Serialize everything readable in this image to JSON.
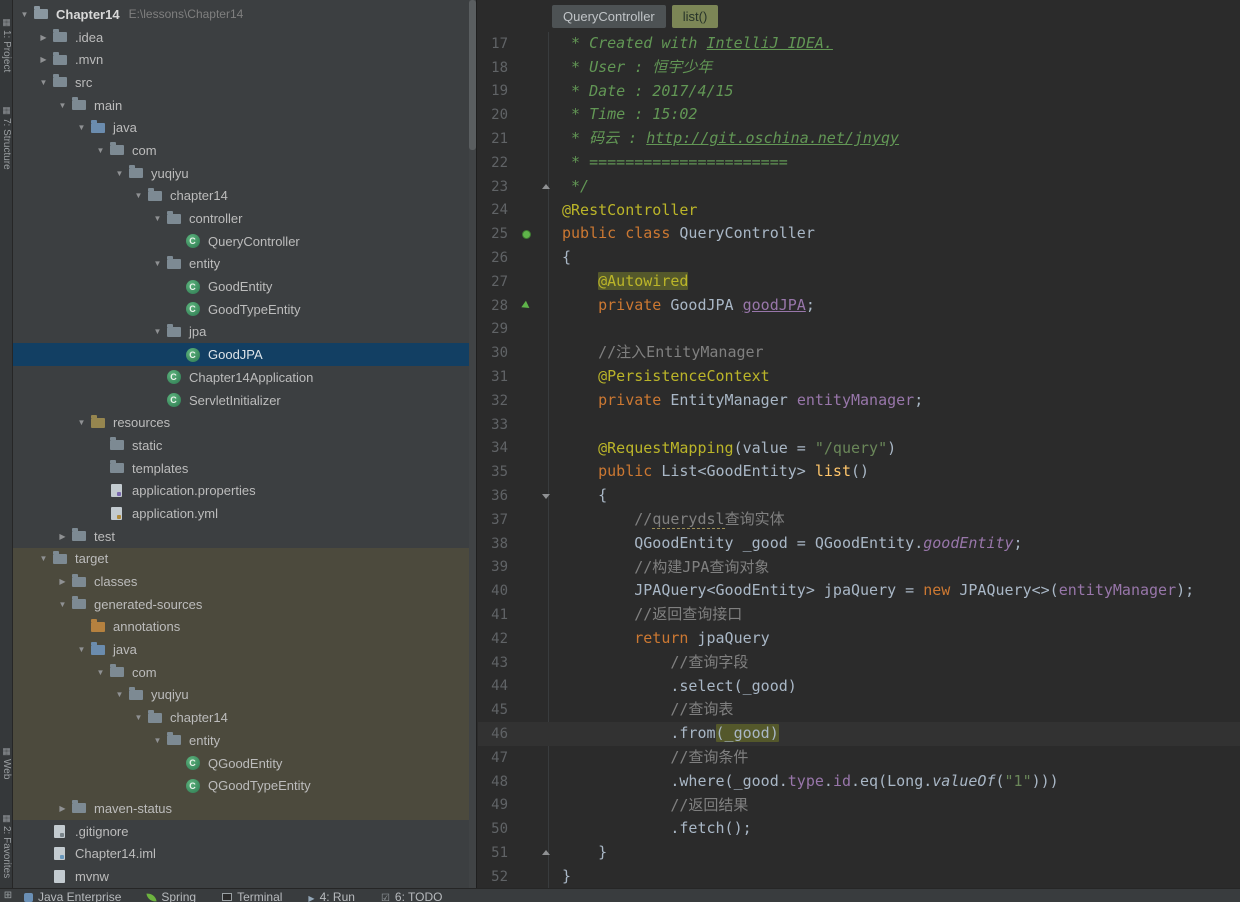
{
  "colors": {
    "editor_bg": "#2b2b2b",
    "panel_bg": "#3c3f41",
    "selection_bg": "#123f63",
    "excluded_bg": "#4c4a3d",
    "highlight_bg": "#54582b",
    "caret_line_bg": "#323232",
    "keyword": "#cc7832",
    "annotation": "#bbb529",
    "string": "#6a8759",
    "comment": "#629755",
    "line_comment": "#808080",
    "field": "#9876aa",
    "method": "#ffc66b",
    "text": "#a9b7c6",
    "line_number": "#606366"
  },
  "left_toolbar": {
    "top": [
      {
        "icon": "project-tool-icon",
        "label": "1: Project"
      },
      {
        "icon": "structure-tool-icon",
        "label": "7: Structure"
      }
    ],
    "bottom": [
      {
        "icon": "web-tool-icon",
        "label": "Web"
      },
      {
        "icon": "favorites-tool-icon",
        "label": "2: Favorites"
      }
    ]
  },
  "project_tree": {
    "items": [
      {
        "label": "Chapter14",
        "path": "E:\\lessons\\Chapter14",
        "level": 0,
        "arrow": "v",
        "icon": "project",
        "bold": true
      },
      {
        "label": ".idea",
        "level": 1,
        "arrow": ">",
        "icon": "folder"
      },
      {
        "label": ".mvn",
        "level": 1,
        "arrow": ">",
        "icon": "folder"
      },
      {
        "label": "src",
        "level": 1,
        "arrow": "v",
        "icon": "folder"
      },
      {
        "label": "main",
        "level": 2,
        "arrow": "v",
        "icon": "folder"
      },
      {
        "label": "java",
        "level": 3,
        "arrow": "v",
        "icon": "folder-src"
      },
      {
        "label": "com",
        "level": 4,
        "arrow": "v",
        "icon": "folder"
      },
      {
        "label": "yuqiyu",
        "level": 5,
        "arrow": "v",
        "icon": "folder"
      },
      {
        "label": "chapter14",
        "level": 6,
        "arrow": "v",
        "icon": "folder"
      },
      {
        "label": "controller",
        "level": 7,
        "arrow": "v",
        "icon": "folder"
      },
      {
        "label": "QueryController",
        "level": 8,
        "arrow": "",
        "icon": "class"
      },
      {
        "label": "entity",
        "level": 7,
        "arrow": "v",
        "icon": "folder"
      },
      {
        "label": "GoodEntity",
        "level": 8,
        "arrow": "",
        "icon": "class"
      },
      {
        "label": "GoodTypeEntity",
        "level": 8,
        "arrow": "",
        "icon": "class"
      },
      {
        "label": "jpa",
        "level": 7,
        "arrow": "v",
        "icon": "folder"
      },
      {
        "label": "GoodJPA",
        "level": 8,
        "arrow": "",
        "icon": "class",
        "selected": true
      },
      {
        "label": "Chapter14Application",
        "level": 7,
        "arrow": "",
        "icon": "class"
      },
      {
        "label": "ServletInitializer",
        "level": 7,
        "arrow": "",
        "icon": "class"
      },
      {
        "label": "resources",
        "level": 3,
        "arrow": "v",
        "icon": "folder-res"
      },
      {
        "label": "static",
        "level": 4,
        "arrow": "",
        "icon": "folder"
      },
      {
        "label": "templates",
        "level": 4,
        "arrow": "",
        "icon": "folder"
      },
      {
        "label": "application.properties",
        "level": 4,
        "arrow": "",
        "icon": "file-props"
      },
      {
        "label": "application.yml",
        "level": 4,
        "arrow": "",
        "icon": "file-yml"
      },
      {
        "label": "test",
        "level": 2,
        "arrow": ">",
        "icon": "folder"
      },
      {
        "label": "target",
        "level": 1,
        "arrow": "v",
        "icon": "folder",
        "excluded": true
      },
      {
        "label": "classes",
        "level": 2,
        "arrow": ">",
        "icon": "folder",
        "excluded": true
      },
      {
        "label": "generated-sources",
        "level": 2,
        "arrow": "v",
        "icon": "folder",
        "excluded": true
      },
      {
        "label": "annotations",
        "level": 3,
        "arrow": "",
        "icon": "folder-gen",
        "excluded": true
      },
      {
        "label": "java",
        "level": 3,
        "arrow": "v",
        "icon": "folder-src",
        "excluded": true
      },
      {
        "label": "com",
        "level": 4,
        "arrow": "v",
        "icon": "folder",
        "excluded": true
      },
      {
        "label": "yuqiyu",
        "level": 5,
        "arrow": "v",
        "icon": "folder",
        "excluded": true
      },
      {
        "label": "chapter14",
        "level": 6,
        "arrow": "v",
        "icon": "folder",
        "excluded": true
      },
      {
        "label": "entity",
        "level": 7,
        "arrow": "v",
        "icon": "folder",
        "excluded": true
      },
      {
        "label": "QGoodEntity",
        "level": 8,
        "arrow": "",
        "icon": "class",
        "excluded": true
      },
      {
        "label": "QGoodTypeEntity",
        "level": 8,
        "arrow": "",
        "icon": "class",
        "excluded": true
      },
      {
        "label": "maven-status",
        "level": 2,
        "arrow": ">",
        "icon": "folder",
        "excluded": true
      },
      {
        "label": ".gitignore",
        "level": 1,
        "arrow": "",
        "icon": "file-git"
      },
      {
        "label": "Chapter14.iml",
        "level": 1,
        "arrow": "",
        "icon": "file-iml"
      },
      {
        "label": "mvnw",
        "level": 1,
        "arrow": "",
        "icon": "file-plain"
      }
    ]
  },
  "editor": {
    "tabs": [
      {
        "label": "QueryController",
        "type": "file"
      },
      {
        "label": "list()",
        "type": "method"
      }
    ],
    "lines": [
      {
        "n": 17,
        "s": [
          {
            "c": "cmt",
            "t": " * Created with "
          },
          {
            "c": "cmtl",
            "t": "IntelliJ IDEA."
          }
        ]
      },
      {
        "n": 18,
        "s": [
          {
            "c": "cmt",
            "t": " * User : 恒宇少年"
          }
        ]
      },
      {
        "n": 19,
        "s": [
          {
            "c": "cmt",
            "t": " * Date : 2017/4/15"
          }
        ]
      },
      {
        "n": 20,
        "s": [
          {
            "c": "cmt",
            "t": " * Time : 15:02"
          }
        ]
      },
      {
        "n": 21,
        "s": [
          {
            "c": "cmt",
            "t": " * 码云 : "
          },
          {
            "c": "cmtl",
            "t": "http://git.oschina.net/jnyqy"
          }
        ]
      },
      {
        "n": 22,
        "s": [
          {
            "c": "cmt",
            "t": " * ======================"
          }
        ]
      },
      {
        "n": 23,
        "g": "fold-end",
        "s": [
          {
            "c": "cmt",
            "t": " */"
          }
        ]
      },
      {
        "n": 24,
        "s": [
          {
            "c": "ann",
            "t": "@RestController"
          }
        ]
      },
      {
        "n": 25,
        "g": "bean",
        "s": [
          {
            "c": "kw",
            "t": "public class "
          },
          {
            "c": "txt",
            "t": "QueryController"
          }
        ]
      },
      {
        "n": 26,
        "s": [
          {
            "c": "txt",
            "t": "{"
          }
        ]
      },
      {
        "n": 27,
        "s": [
          {
            "c": "txt",
            "t": "    "
          },
          {
            "c": "ann hl",
            "t": "@Autowired"
          }
        ]
      },
      {
        "n": 28,
        "g": "nav",
        "s": [
          {
            "c": "txt",
            "t": "    "
          },
          {
            "c": "kw",
            "t": "private "
          },
          {
            "c": "txt",
            "t": "GoodJPA "
          },
          {
            "c": "fldu",
            "t": "goodJPA"
          },
          {
            "c": "txt",
            "t": ";"
          }
        ]
      },
      {
        "n": 29,
        "s": []
      },
      {
        "n": 30,
        "s": [
          {
            "c": "txt",
            "t": "    "
          },
          {
            "c": "lc",
            "t": "//注入EntityManager"
          }
        ]
      },
      {
        "n": 31,
        "s": [
          {
            "c": "txt",
            "t": "    "
          },
          {
            "c": "ann",
            "t": "@PersistenceContext"
          }
        ]
      },
      {
        "n": 32,
        "s": [
          {
            "c": "txt",
            "t": "    "
          },
          {
            "c": "kw",
            "t": "private "
          },
          {
            "c": "txt",
            "t": "EntityManager "
          },
          {
            "c": "fld",
            "t": "entityManager"
          },
          {
            "c": "txt",
            "t": ";"
          }
        ]
      },
      {
        "n": 33,
        "s": []
      },
      {
        "n": 34,
        "s": [
          {
            "c": "txt",
            "t": "    "
          },
          {
            "c": "ann",
            "t": "@RequestMapping"
          },
          {
            "c": "txt",
            "t": "(value = "
          },
          {
            "c": "str",
            "t": "\"/query\""
          },
          {
            "c": "txt",
            "t": ")"
          }
        ]
      },
      {
        "n": 35,
        "s": [
          {
            "c": "txt",
            "t": "    "
          },
          {
            "c": "kw",
            "t": "public "
          },
          {
            "c": "txt",
            "t": "List<GoodEntity> "
          },
          {
            "c": "mth",
            "t": "list"
          },
          {
            "c": "txt",
            "t": "()"
          }
        ]
      },
      {
        "n": 36,
        "g": "fold-start",
        "s": [
          {
            "c": "txt",
            "t": "    {"
          }
        ]
      },
      {
        "n": 37,
        "s": [
          {
            "c": "txt",
            "t": "        "
          },
          {
            "c": "lc",
            "t": "//"
          },
          {
            "c": "lcu",
            "t": "querydsl"
          },
          {
            "c": "lc",
            "t": "查询实体"
          }
        ]
      },
      {
        "n": 38,
        "s": [
          {
            "c": "txt",
            "t": "        QGoodEntity _good = QGoodEntity."
          },
          {
            "c": "flds",
            "t": "goodEntity"
          },
          {
            "c": "txt",
            "t": ";"
          }
        ]
      },
      {
        "n": 39,
        "s": [
          {
            "c": "txt",
            "t": "        "
          },
          {
            "c": "lc",
            "t": "//构建JPA查询对象"
          }
        ]
      },
      {
        "n": 40,
        "s": [
          {
            "c": "txt",
            "t": "        JPAQuery<GoodEntity> jpaQuery = "
          },
          {
            "c": "kw",
            "t": "new "
          },
          {
            "c": "txt",
            "t": "JPAQuery<>("
          },
          {
            "c": "fld",
            "t": "entityManager"
          },
          {
            "c": "txt",
            "t": ");"
          }
        ]
      },
      {
        "n": 41,
        "s": [
          {
            "c": "txt",
            "t": "        "
          },
          {
            "c": "lc",
            "t": "//返回查询接口"
          }
        ]
      },
      {
        "n": 42,
        "s": [
          {
            "c": "txt",
            "t": "        "
          },
          {
            "c": "kw",
            "t": "return "
          },
          {
            "c": "txt",
            "t": "jpaQuery"
          }
        ]
      },
      {
        "n": 43,
        "s": [
          {
            "c": "txt",
            "t": "            "
          },
          {
            "c": "lc",
            "t": "//查询字段"
          }
        ]
      },
      {
        "n": 44,
        "s": [
          {
            "c": "txt",
            "t": "            .select(_good)"
          }
        ]
      },
      {
        "n": 45,
        "s": [
          {
            "c": "txt",
            "t": "            "
          },
          {
            "c": "lc",
            "t": "//查询表"
          }
        ]
      },
      {
        "n": 46,
        "cur": true,
        "s": [
          {
            "c": "txt",
            "t": "            .from"
          },
          {
            "c": "txthl",
            "t": "(_good)"
          }
        ]
      },
      {
        "n": 47,
        "s": [
          {
            "c": "txt",
            "t": "            "
          },
          {
            "c": "lc",
            "t": "//查询条件"
          }
        ]
      },
      {
        "n": 48,
        "s": [
          {
            "c": "txt",
            "t": "            .where(_good."
          },
          {
            "c": "fld",
            "t": "type"
          },
          {
            "c": "txt",
            "t": "."
          },
          {
            "c": "fld",
            "t": "id"
          },
          {
            "c": "txt",
            "t": ".eq(Long."
          },
          {
            "c": "mthi",
            "t": "valueOf"
          },
          {
            "c": "txt",
            "t": "("
          },
          {
            "c": "str",
            "t": "\"1\""
          },
          {
            "c": "txt",
            "t": ")))"
          }
        ]
      },
      {
        "n": 49,
        "s": [
          {
            "c": "txt",
            "t": "            "
          },
          {
            "c": "lc",
            "t": "//返回结果"
          }
        ]
      },
      {
        "n": 50,
        "s": [
          {
            "c": "txt",
            "t": "            .fetch();"
          }
        ]
      },
      {
        "n": 51,
        "g": "fold-end",
        "s": [
          {
            "c": "txt",
            "t": "    }"
          }
        ]
      },
      {
        "n": 52,
        "s": [
          {
            "c": "txt",
            "t": "}"
          }
        ]
      }
    ]
  },
  "status_bar": {
    "corner_icon": "grid-icon",
    "corner_glyph": "⊞",
    "items": [
      {
        "icon": "java-enterprise-icon",
        "label": "Java Enterprise"
      },
      {
        "icon": "spring-icon",
        "label": "Spring"
      },
      {
        "icon": "terminal-icon",
        "label": "Terminal"
      },
      {
        "icon": "run-icon",
        "label": "4: Run"
      },
      {
        "icon": "todo-icon",
        "label": "6: TODO"
      }
    ]
  }
}
